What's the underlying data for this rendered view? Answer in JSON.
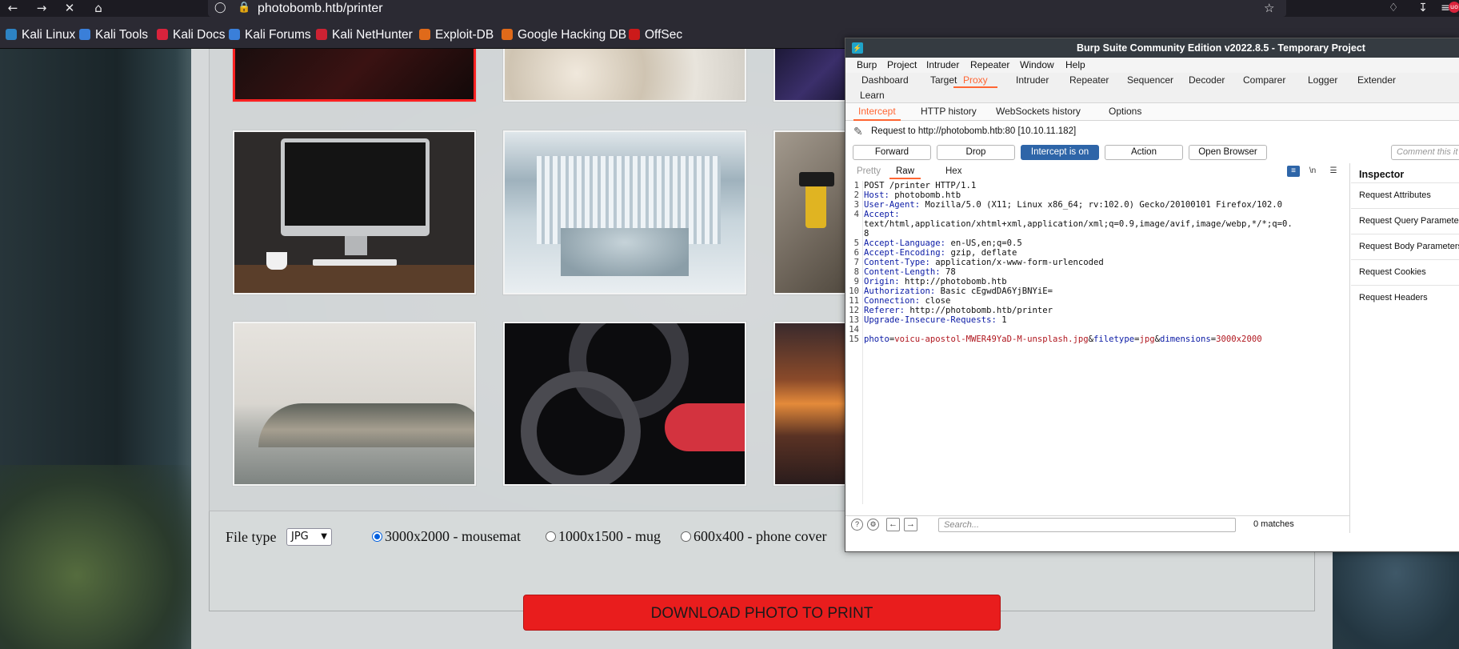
{
  "browser": {
    "url": "photobomb.htb/printer",
    "bookmarks": [
      {
        "label": "Kali Linux",
        "color": "#2d83c4"
      },
      {
        "label": "Kali Tools",
        "color": "#3a7fd9"
      },
      {
        "label": "Kali Docs",
        "color": "#d9233c"
      },
      {
        "label": "Kali Forums",
        "color": "#3a7fd9"
      },
      {
        "label": "Kali NetHunter",
        "color": "#cc2233"
      },
      {
        "label": "Exploit-DB",
        "color": "#e06a1a"
      },
      {
        "label": "Google Hacking DB",
        "color": "#e06a1a"
      },
      {
        "label": "OffSec",
        "color": "#cc1a1a"
      }
    ],
    "ext_badge": "uo"
  },
  "page": {
    "file_type_label": "File type",
    "file_type_value": "JPG",
    "dimension_options": [
      {
        "label": "3000x2000 - mousemat",
        "selected": true
      },
      {
        "label": "1000x1500 - mug",
        "selected": false
      },
      {
        "label": "600x400 - phone cover",
        "selected": false
      }
    ],
    "download_label": "DOWNLOAD PHOTO TO PRINT"
  },
  "burp": {
    "title": "Burp Suite Community Edition v2022.8.5 - Temporary Project",
    "menu": [
      "Burp",
      "Project",
      "Intruder",
      "Repeater",
      "Window",
      "Help"
    ],
    "tabs": [
      "Dashboard",
      "Target",
      "Proxy",
      "Intruder",
      "Repeater",
      "Sequencer",
      "Decoder",
      "Comparer",
      "Logger",
      "Extender",
      "Learn"
    ],
    "active_tab": "Proxy",
    "subtabs": [
      "Intercept",
      "HTTP history",
      "WebSockets history",
      "Options"
    ],
    "active_subtab": "Intercept",
    "request_info": "Request to http://photobomb.htb:80  [10.10.11.182]",
    "actions": {
      "forward": "Forward",
      "drop": "Drop",
      "intercept": "Intercept is on",
      "action": "Action",
      "open_browser": "Open Browser"
    },
    "comment_placeholder": "Comment this it",
    "editor_tabs": [
      "Pretty",
      "Raw",
      "Hex"
    ],
    "active_editor_tab": "Raw",
    "editor_tools": [
      "wrap-icon",
      "newline-icon",
      "menu-icon"
    ],
    "newline_tool_label": "\\n",
    "request_lines": [
      {
        "n": "1",
        "text": "POST /printer HTTP/1.1"
      },
      {
        "n": "2",
        "name": "Host",
        "value": " photobomb.htb"
      },
      {
        "n": "3",
        "name": "User-Agent",
        "value": " Mozilla/5.0 (X11; Linux x86_64; rv:102.0) Gecko/20100101 Firefox/102.0"
      },
      {
        "n": "4",
        "name": "Accept",
        "value": ""
      },
      {
        "n": "",
        "text": "text/html,application/xhtml+xml,application/xml;q=0.9,image/avif,image/webp,*/*;q=0."
      },
      {
        "n": "",
        "text": "8"
      },
      {
        "n": "5",
        "name": "Accept-Language",
        "value": " en-US,en;q=0.5"
      },
      {
        "n": "6",
        "name": "Accept-Encoding",
        "value": " gzip, deflate"
      },
      {
        "n": "7",
        "name": "Content-Type",
        "value": " application/x-www-form-urlencoded"
      },
      {
        "n": "8",
        "name": "Content-Length",
        "value": " 78"
      },
      {
        "n": "9",
        "name": "Origin",
        "value": " http://photobomb.htb"
      },
      {
        "n": "10",
        "name": "Authorization",
        "value": " Basic cEgwdDA6YjBNYiE="
      },
      {
        "n": "11",
        "name": "Connection",
        "value": " close"
      },
      {
        "n": "12",
        "name": "Referer",
        "value": " http://photobomb.htb/printer"
      },
      {
        "n": "13",
        "name": "Upgrade-Insecure-Requests",
        "value": " 1"
      },
      {
        "n": "14",
        "text": ""
      }
    ],
    "body_line": {
      "n": "15",
      "params": [
        {
          "key": "photo",
          "value": "voicu-apostol-MWER49YaD-M-unsplash.jpg"
        },
        {
          "key": "filetype",
          "value": "jpg"
        },
        {
          "key": "dimensions",
          "value": "3000x2000"
        }
      ]
    },
    "search_placeholder": "Search...",
    "matches": "0 matches",
    "inspector": {
      "title": "Inspector",
      "rows": [
        "Request Attributes",
        "Request Query Parameters",
        "Request Body Parameters",
        "Request Cookies",
        "Request Headers"
      ]
    }
  }
}
